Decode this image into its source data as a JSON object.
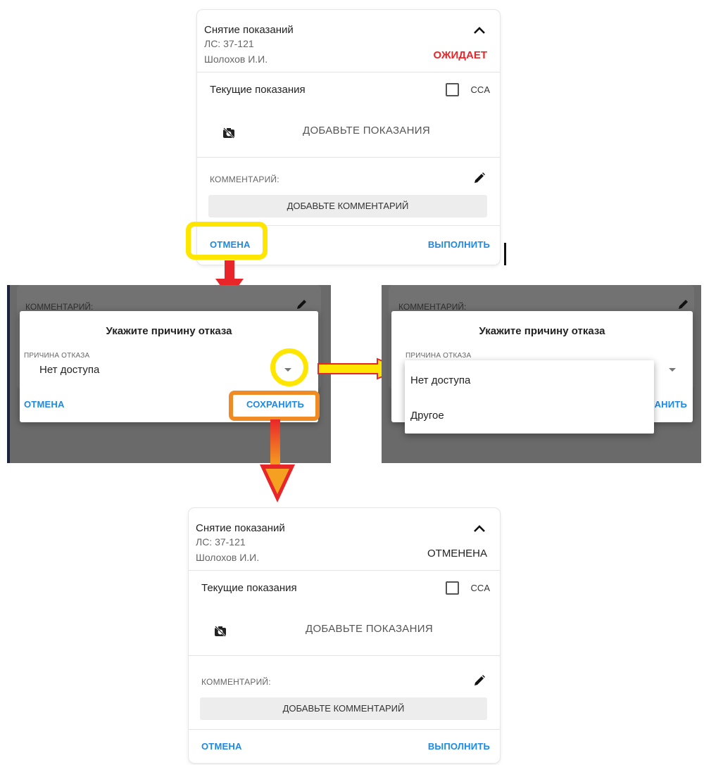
{
  "top_card": {
    "title": "Снятие показаний",
    "account": "ЛС: 37-121",
    "owner": "Шолохов И.И.",
    "status": "ОЖИДАЕТ",
    "status_color": "#e8262a",
    "readings_label": "Текущие показания",
    "cca_label": "CCA",
    "add_readings": "ДОБАВЬТЕ ПОКАЗАНИЯ",
    "comment_label": "КОММЕНТАРИЙ:",
    "add_comment": "ДОБАВЬТЕ КОММЕНТАРИЙ",
    "cancel": "ОТМЕНА",
    "complete": "ВЫПОЛНИТЬ"
  },
  "dialog_left": {
    "bg_comment_label": "КОММЕНТАРИЙ:",
    "title": "Укажите причину отказа",
    "reason_label": "ПРИЧИНА ОТКАЗА",
    "reason_value": "Нет доступа",
    "cancel": "ОТМЕНА",
    "save": "СОХРАНИТЬ"
  },
  "dialog_right": {
    "bg_comment_label": "КОММЕНТАРИЙ:",
    "title": "Укажите причину отказа",
    "reason_label": "ПРИЧИНА ОТКАЗА",
    "save_partial": "АНИТЬ",
    "options": [
      "Нет доступа",
      "Другое"
    ]
  },
  "bottom_card": {
    "title": "Снятие показаний",
    "account": "ЛС: 37-121",
    "owner": "Шолохов И.И.",
    "status": "ОТМЕНЕНА",
    "readings_label": "Текущие показания",
    "cca_label": "CCA",
    "add_readings": "ДОБАВЬТЕ ПОКАЗАНИЯ",
    "comment_label": "КОММЕНТАРИЙ:",
    "add_comment": "ДОБАВЬТЕ КОММЕНТАРИЙ",
    "cancel": "ОТМЕНА",
    "complete": "ВЫПОЛНИТЬ"
  },
  "colors": {
    "link_blue": "#1e88e5",
    "highlight_yellow": "#ffe600",
    "highlight_orange": "#f08a24",
    "arrow_red": "#e8262a",
    "overlay_gray": "#6a6a6a"
  },
  "icons": [
    "chevron-up-icon",
    "camera-off-icon",
    "pencil-icon",
    "dropdown-caret-icon",
    "checkbox-icon"
  ]
}
